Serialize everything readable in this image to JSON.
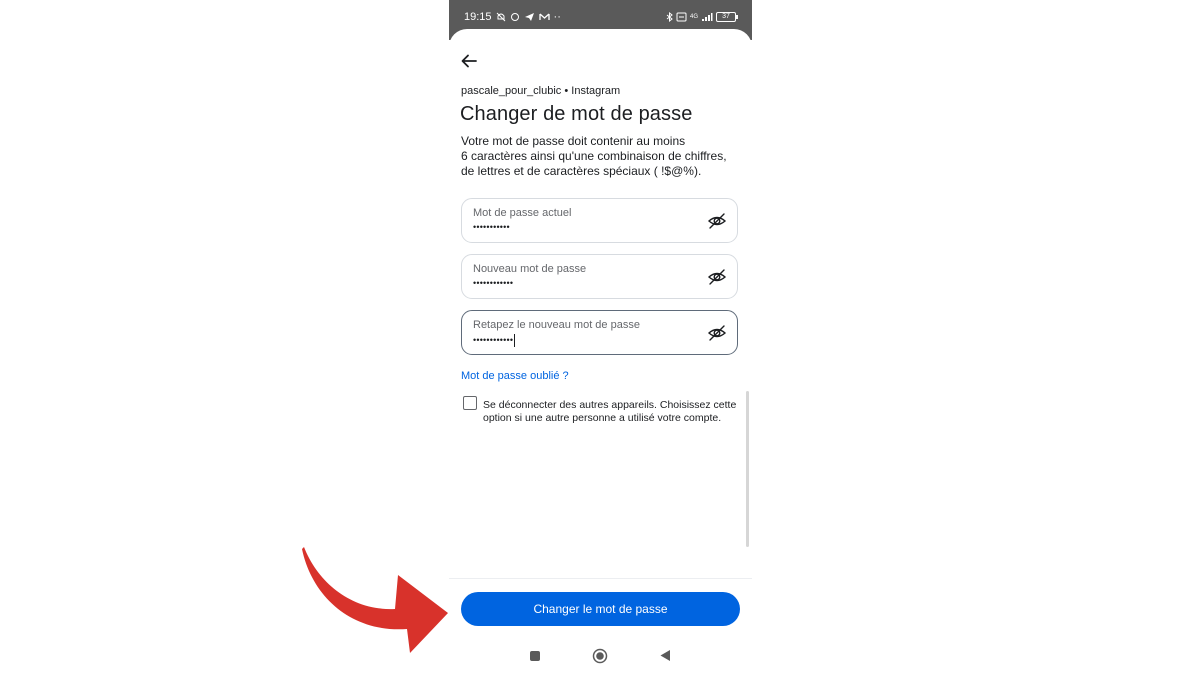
{
  "status_bar": {
    "time": "19:15",
    "dots": "··",
    "network": "4G",
    "battery": "37"
  },
  "account": {
    "username": "pascale_pour_clubic",
    "separator": " • ",
    "service": "Instagram"
  },
  "title": "Changer de mot de passe",
  "description": {
    "line1": "Votre mot de passe doit contenir au moins",
    "line2": "6 caractères ainsi qu'une combinaison de chiffres,",
    "line3": "de lettres et de caractères spéciaux ( !$@%)."
  },
  "fields": [
    {
      "label": "Mot de passe actuel",
      "value": "•••••••••••"
    },
    {
      "label": "Nouveau mot de passe",
      "value": "••••••••••••"
    },
    {
      "label": "Retapez le nouveau mot de passe",
      "value": "••••••••••••"
    }
  ],
  "forgot_link": "Mot de passe oublié ?",
  "logout_option": {
    "checked": false,
    "line1": "Se déconnecter des autres appareils. Choisissez cette",
    "line2": "option si une autre personne a utilisé votre compte."
  },
  "submit_label": "Changer le mot de passe",
  "icons": {
    "back": "arrow-left-icon",
    "toggle_visibility": "eye-off-icon",
    "nav_recents": "square-icon",
    "nav_home": "circle-icon",
    "nav_back": "triangle-back-icon"
  },
  "colors": {
    "primary": "#0064e0",
    "text": "#1c1e21",
    "secondary_text": "#65676b",
    "status_bar": "#5a5a5a",
    "annotation_arrow": "#d8322b"
  }
}
